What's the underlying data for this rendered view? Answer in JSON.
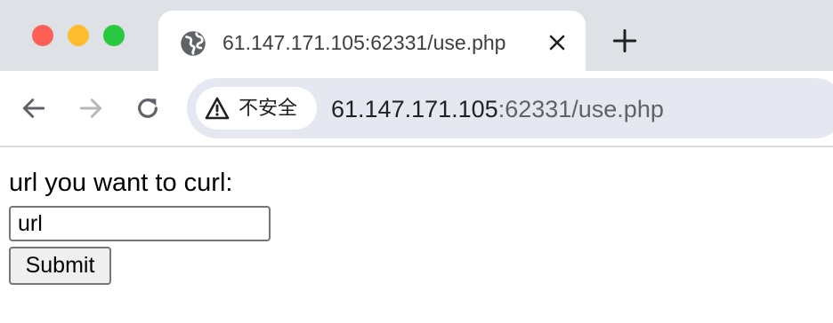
{
  "browser": {
    "tab": {
      "title": "61.147.171.105:62331/use.php",
      "icon": "globe-icon"
    },
    "new_tab_icon": "plus-icon",
    "security_chip": {
      "icon": "warning-triangle-icon",
      "label": "不安全"
    },
    "address": {
      "host": "61.147.171.105",
      "path": ":62331/use.php"
    }
  },
  "page": {
    "form_label": "url you want to curl:",
    "url_input": {
      "value": "url"
    },
    "submit_label": "Submit"
  }
}
